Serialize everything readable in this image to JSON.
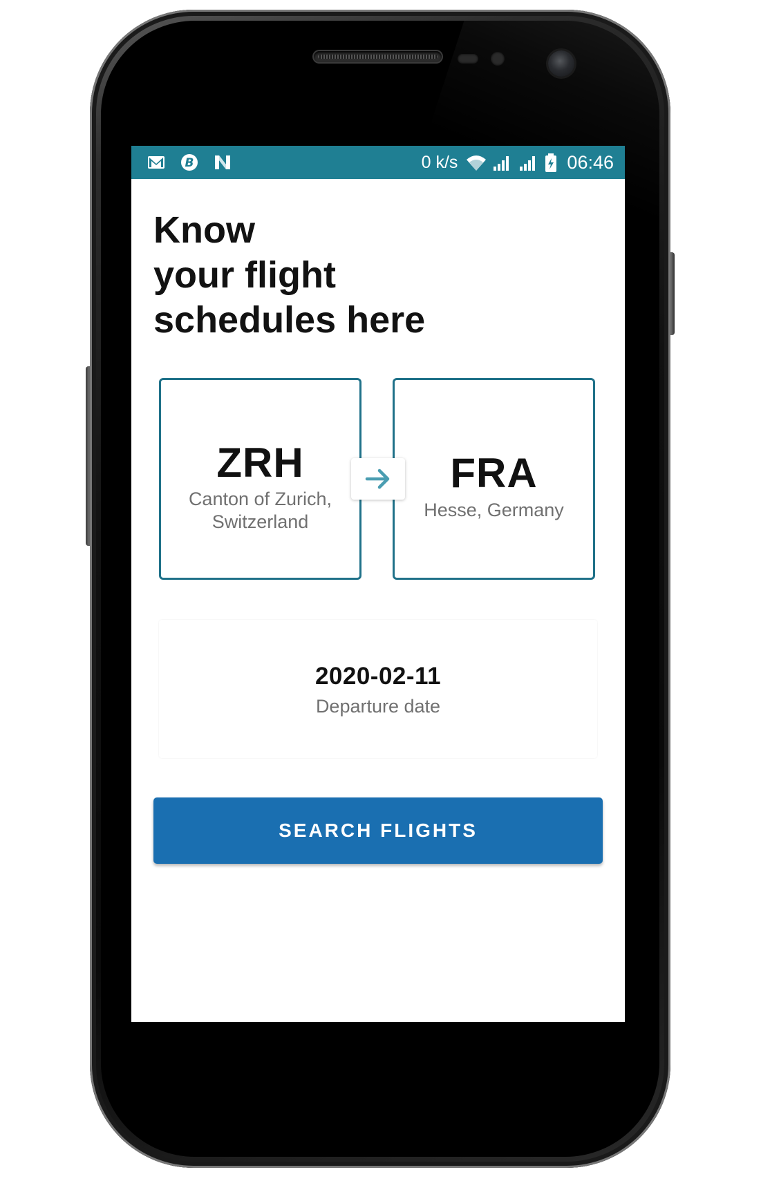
{
  "status_bar": {
    "notification_icons": [
      "gmail-icon",
      "bitcoin-icon",
      "n-app-icon"
    ],
    "net_speed": "0 k/s",
    "time": "06:46"
  },
  "headline": {
    "line1": "Know",
    "line2": "your flight",
    "line3": "schedules here"
  },
  "origin": {
    "code": "ZRH",
    "region_line1": "Canton of Zurich,",
    "region_line2": "Switzerland"
  },
  "destination": {
    "code": "FRA",
    "region": "Hesse, Germany"
  },
  "swap_icon": "arrow-right-icon",
  "departure": {
    "date": "2020-02-11",
    "label": "Departure date"
  },
  "search_button": {
    "label": "SEARCH FLIGHTS"
  },
  "colors": {
    "status_bar": "#1f7f93",
    "card_border": "#1f7189",
    "arrow": "#4a9db1",
    "button": "#1a6fb1"
  }
}
